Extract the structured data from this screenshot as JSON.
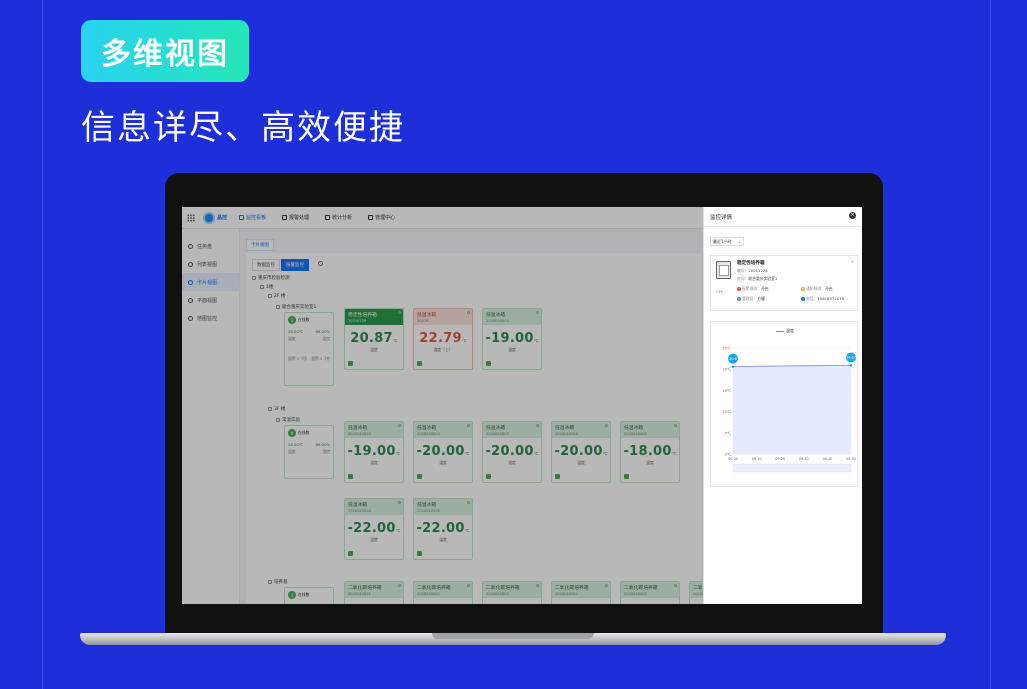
{
  "hero": {
    "badge": "多维视图",
    "subtitle": "信息详尽、高效便捷"
  },
  "app": {
    "brand": "晶控",
    "nav": [
      {
        "label": "监控看板",
        "active": true
      },
      {
        "label": "报警处理",
        "active": false
      },
      {
        "label": "统计分析",
        "active": false
      },
      {
        "label": "管理中心",
        "active": false
      }
    ],
    "sidebar": [
      {
        "label": "任务盘",
        "active": false
      },
      {
        "label": "列表视图",
        "active": false
      },
      {
        "label": "卡片视图",
        "active": true
      },
      {
        "label": "平面视图",
        "active": false
      },
      {
        "label": "地图监控",
        "active": false
      }
    ],
    "main_tab": "卡片视图",
    "segments": [
      {
        "label": "数据监控",
        "active": false
      },
      {
        "label": "报警监控",
        "active": true
      }
    ],
    "tree": {
      "root": "重庆市检验检测",
      "building": "1楼",
      "floor_2f": "2F 楼",
      "lab_1": "联合重庆实验室1",
      "floor_3f": "3F 楼",
      "lab_2": "常温实验",
      "lab_3": "培养基"
    },
    "groups": [
      {
        "count": "3",
        "label": "在线数",
        "v1": "26.00℃",
        "v2": "66.00%",
        "l1": "温度",
        "l2": "湿度"
      },
      {
        "count": "9",
        "label": "在线数",
        "v1": "26.00℃",
        "v2": "66.00%",
        "l1": "温度",
        "l2": "湿度"
      },
      {
        "count": "4",
        "label": "在线数"
      }
    ],
    "group_alert": {
      "a": "报警 0（项",
      "b": "报警 0（外"
    },
    "devices_row1": [
      {
        "name": "稳定性培养箱",
        "code": "20210228",
        "temp": "20.87",
        "unit": "℃",
        "label": "温度",
        "state": "active"
      },
      {
        "name": "低温冰箱",
        "code": "2021R",
        "temp": "22.79",
        "unit": "℃",
        "label": "温度（上）",
        "state": "alarm"
      },
      {
        "name": "低温冰箱",
        "code": "2020040003",
        "temp": "-19.00",
        "unit": "℃",
        "label": "温度",
        "state": "normal"
      }
    ],
    "devices_row2": [
      {
        "name": "低温冰箱",
        "code": "2020040003",
        "temp": "-19.00",
        "unit": "℃",
        "label": "温度"
      },
      {
        "name": "低温冰箱",
        "code": "2020040005",
        "temp": "-20.00",
        "unit": "℃",
        "label": "温度"
      },
      {
        "name": "低温冰箱",
        "code": "2020040007",
        "temp": "-20.00",
        "unit": "℃",
        "label": "温度"
      },
      {
        "name": "低温冰箱",
        "code": "2020040008",
        "temp": "-20.00",
        "unit": "℃",
        "label": "温度"
      },
      {
        "name": "低温冰箱",
        "code": "2020040009",
        "temp": "-18.00",
        "unit": "℃",
        "label": "温度"
      }
    ],
    "devices_row3": [
      {
        "name": "低温冰箱",
        "code": "2020040004",
        "temp": "-22.00",
        "unit": "℃",
        "label": "温度"
      },
      {
        "name": "低温冰箱",
        "code": "2020040006",
        "temp": "-22.00",
        "unit": "℃",
        "label": "温度"
      }
    ],
    "devices_row4": [
      {
        "name": "二氧化碳培养箱",
        "code": "2020040001"
      },
      {
        "name": "二氧化碳培养箱",
        "code": "2020040002"
      },
      {
        "name": "二氧化碳培养箱",
        "code": "2020040003"
      },
      {
        "name": "二氧化碳培养箱",
        "code": "2020040004"
      },
      {
        "name": "二氧化碳培养箱",
        "code": "2020040005"
      },
      {
        "name": "二氧化碳培养箱",
        "code": "2020040006"
      }
    ]
  },
  "drawer": {
    "title": "监控详情",
    "range": "最近1小时",
    "device": {
      "name": "稳定性培养箱",
      "code_label": "编号：",
      "code": "20211228",
      "room_label": "房间：",
      "room": "联合重庆实验室1",
      "alarm_label": "报警规则：",
      "alarm": "开启",
      "notify_label": "通知规则：",
      "notify": "开启",
      "manager_label": "管理员：",
      "manager": "方耀",
      "phone_label": "电话：",
      "phone": "15618572075",
      "status": "OFF"
    },
    "chart_legend": "温度"
  },
  "chart_data": {
    "type": "line",
    "title": "",
    "series": [
      {
        "name": "温度",
        "x": [
          "09:00",
          "09:10",
          "09:20",
          "09:30",
          "09:40",
          "09:50"
        ],
        "values": [
          20.6,
          20.7,
          20.75,
          20.8,
          20.85,
          20.87
        ]
      }
    ],
    "x": [
      "09:00",
      "09:10",
      "09:20",
      "09:30",
      "09:40",
      "09:50"
    ],
    "yticks": [
      "25℃",
      "20℃",
      "15℃",
      "10℃",
      "5℃",
      "0℃"
    ],
    "ylim": [
      0,
      25
    ],
    "start_label": "20.6",
    "end_label": "20.87"
  },
  "colors": {
    "bg": "#1c2fd9",
    "accent": "#1677ff",
    "green": "#2e8b4a",
    "alarm": "#e05a49"
  }
}
